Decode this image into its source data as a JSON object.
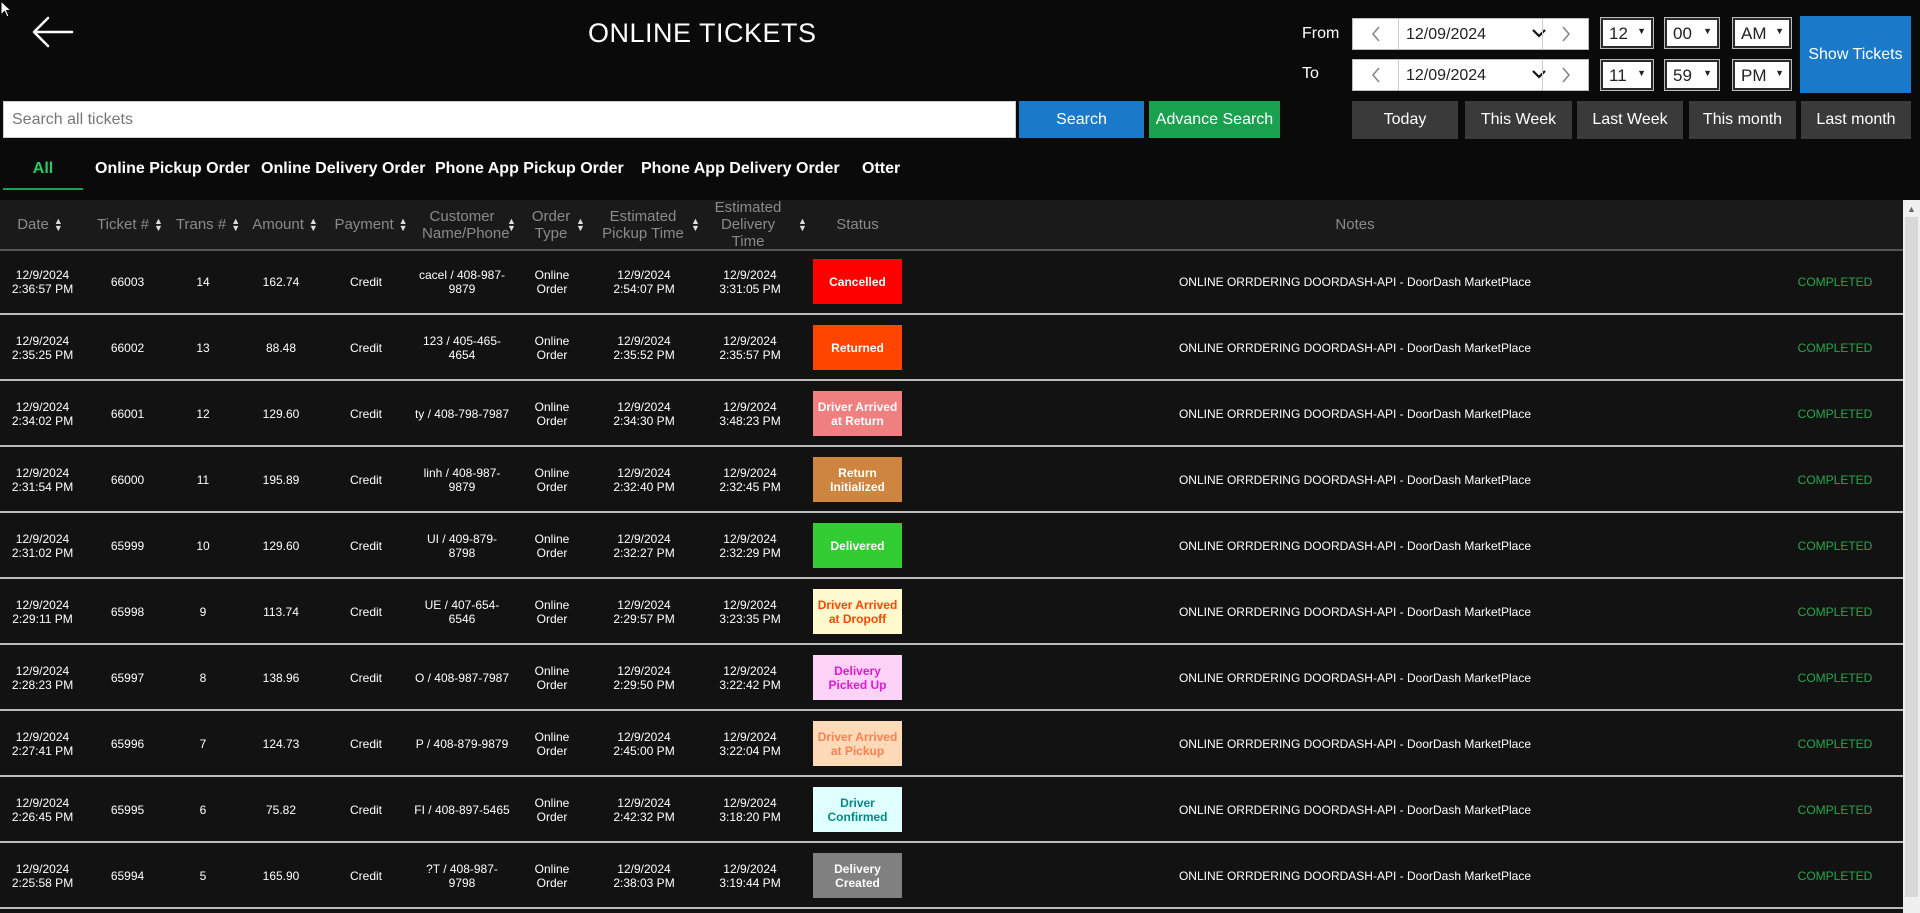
{
  "header": {
    "title": "ONLINE TICKETS",
    "back_icon": "arrow-left-icon"
  },
  "search": {
    "placeholder": "Search all tickets",
    "search_label": "Search",
    "advanced_label": "Advance Search"
  },
  "range": {
    "from_label": "From",
    "to_label": "To",
    "from_date": "12/09/2024",
    "to_date": "12/09/2024",
    "from_hour": "12",
    "from_minute": "00",
    "from_ampm": "AM",
    "to_hour": "11",
    "to_minute": "59",
    "to_ampm": "PM",
    "show_label": "Show Tickets"
  },
  "quick": [
    "Today",
    "This Week",
    "Last Week",
    "This month",
    "Last month"
  ],
  "tabs": [
    "All",
    "Online Pickup Order",
    "Online Delivery Order",
    "Phone App Pickup Order",
    "Phone App Delivery Order",
    "Otter"
  ],
  "active_tab": "All",
  "columns": [
    "Date",
    "Ticket #",
    "Trans #",
    "Amount",
    "Payment",
    "Customer Name/Phone",
    "Order Type",
    "Estimated Pickup Time",
    "Estimated Delivery Time",
    "Status",
    "Notes"
  ],
  "rows": [
    {
      "date": "12/9/2024 2:36:57 PM",
      "ticket": "66003",
      "trans": "14",
      "amount": "162.74",
      "payment": "Credit",
      "customer": "cacel / 408-987-9879",
      "type": "Online Order",
      "pickup": "12/9/2024 2:54:07 PM",
      "delivery": "12/9/2024 3:31:05 PM",
      "status": "Cancelled",
      "note": "ONLINE ORRDERING DOORDASH-API - DoorDash MarketPlace",
      "state": "COMPLETED"
    },
    {
      "date": "12/9/2024 2:35:25 PM",
      "ticket": "66002",
      "trans": "13",
      "amount": "88.48",
      "payment": "Credit",
      "customer": "123 / 405-465-4654",
      "type": "Online Order",
      "pickup": "12/9/2024 2:35:52 PM",
      "delivery": "12/9/2024 2:35:57 PM",
      "status": "Returned",
      "note": "ONLINE ORRDERING DOORDASH-API - DoorDash MarketPlace",
      "state": "COMPLETED"
    },
    {
      "date": "12/9/2024 2:34:02 PM",
      "ticket": "66001",
      "trans": "12",
      "amount": "129.60",
      "payment": "Credit",
      "customer": "ty / 408-798-7987",
      "type": "Online Order",
      "pickup": "12/9/2024 2:34:30 PM",
      "delivery": "12/9/2024 3:48:23 PM",
      "status": "Driver Arrived at Return",
      "note": "ONLINE ORRDERING DOORDASH-API - DoorDash MarketPlace",
      "state": "COMPLETED"
    },
    {
      "date": "12/9/2024 2:31:54 PM",
      "ticket": "66000",
      "trans": "11",
      "amount": "195.89",
      "payment": "Credit",
      "customer": "linh / 408-987-9879",
      "type": "Online Order",
      "pickup": "12/9/2024 2:32:40 PM",
      "delivery": "12/9/2024 2:32:45 PM",
      "status": "Return Initialized",
      "note": "ONLINE ORRDERING DOORDASH-API - DoorDash MarketPlace",
      "state": "COMPLETED"
    },
    {
      "date": "12/9/2024 2:31:02 PM",
      "ticket": "65999",
      "trans": "10",
      "amount": "129.60",
      "payment": "Credit",
      "customer": "UI / 409-879-8798",
      "type": "Online Order",
      "pickup": "12/9/2024 2:32:27 PM",
      "delivery": "12/9/2024 2:32:29 PM",
      "status": "Delivered",
      "note": "ONLINE ORRDERING DOORDASH-API - DoorDash MarketPlace",
      "state": "COMPLETED"
    },
    {
      "date": "12/9/2024 2:29:11 PM",
      "ticket": "65998",
      "trans": "9",
      "amount": "113.74",
      "payment": "Credit",
      "customer": "UE / 407-654-6546",
      "type": "Online Order",
      "pickup": "12/9/2024 2:29:57 PM",
      "delivery": "12/9/2024 3:23:35 PM",
      "status": "Driver Arrived at Dropoff",
      "note": "ONLINE ORRDERING DOORDASH-API - DoorDash MarketPlace",
      "state": "COMPLETED"
    },
    {
      "date": "12/9/2024 2:28:23 PM",
      "ticket": "65997",
      "trans": "8",
      "amount": "138.96",
      "payment": "Credit",
      "customer": "O / 408-987-7987",
      "type": "Online Order",
      "pickup": "12/9/2024 2:29:50 PM",
      "delivery": "12/9/2024 3:22:42 PM",
      "status": "Delivery Picked Up",
      "note": "ONLINE ORRDERING DOORDASH-API - DoorDash MarketPlace",
      "state": "COMPLETED"
    },
    {
      "date": "12/9/2024 2:27:41 PM",
      "ticket": "65996",
      "trans": "7",
      "amount": "124.73",
      "payment": "Credit",
      "customer": "P / 408-879-9879",
      "type": "Online Order",
      "pickup": "12/9/2024 2:45:00 PM",
      "delivery": "12/9/2024 3:22:04 PM",
      "status": "Driver Arrived at Pickup",
      "note": "ONLINE ORRDERING DOORDASH-API - DoorDash MarketPlace",
      "state": "COMPLETED"
    },
    {
      "date": "12/9/2024 2:26:45 PM",
      "ticket": "65995",
      "trans": "6",
      "amount": "75.82",
      "payment": "Credit",
      "customer": "FI / 408-897-5465",
      "type": "Online Order",
      "pickup": "12/9/2024 2:42:32 PM",
      "delivery": "12/9/2024 3:18:20 PM",
      "status": "Driver Confirmed",
      "note": "ONLINE ORRDERING DOORDASH-API - DoorDash MarketPlace",
      "state": "COMPLETED"
    },
    {
      "date": "12/9/2024 2:25:58 PM",
      "ticket": "65994",
      "trans": "5",
      "amount": "165.90",
      "payment": "Credit",
      "customer": "?T / 408-987-9798",
      "type": "Online Order",
      "pickup": "12/9/2024 2:38:03 PM",
      "delivery": "12/9/2024 3:19:44 PM",
      "status": "Delivery Created",
      "note": "ONLINE ORRDERING DOORDASH-API - DoorDash MarketPlace",
      "state": "COMPLETED"
    }
  ],
  "status_colors": {
    "Cancelled": {
      "bg": "#ff0000",
      "fg": "#ffffff"
    },
    "Returned": {
      "bg": "#ff4500",
      "fg": "#ffffff"
    },
    "Driver Arrived at Return": {
      "bg": "#f08080",
      "fg": "#ffffff"
    },
    "Return Initialized": {
      "bg": "#cd853f",
      "fg": "#ffffff"
    },
    "Delivered": {
      "bg": "#32cd32",
      "fg": "#ffffff"
    },
    "Driver Arrived at Dropoff": {
      "bg": "#fffacd",
      "fg": "#ff4500"
    },
    "Delivery Picked Up": {
      "bg": "#ffd3f7",
      "fg": "#e01ad8"
    },
    "Driver Arrived at Pickup": {
      "bg": "#ffdab9",
      "fg": "#ff7f50"
    },
    "Driver Confirmed": {
      "bg": "#e0ffff",
      "fg": "#008b8b"
    },
    "Delivery Created": {
      "bg": "#808080",
      "fg": "#ffffff"
    }
  }
}
